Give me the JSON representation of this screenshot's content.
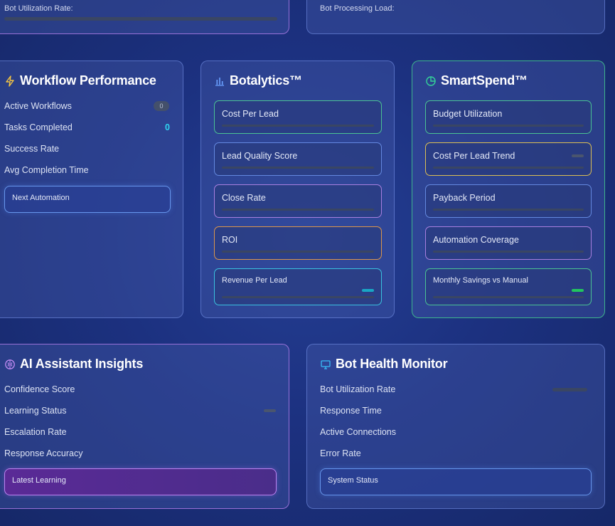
{
  "top_left_card": {
    "label": "Bot Utilization Rate:"
  },
  "top_right_card": {
    "label": "Bot Processing Load:"
  },
  "workflow": {
    "title": "Workflow Performance",
    "icon": "lightning-icon",
    "rows": [
      {
        "label": "Active Workflows",
        "value": "0"
      },
      {
        "label": "Tasks Completed",
        "value": "0"
      },
      {
        "label": "Success Rate"
      },
      {
        "label": "Avg Completion Time"
      }
    ],
    "next_automation": "Next Automation"
  },
  "botalytics": {
    "title": "Botalytics™",
    "icon": "bar-chart-icon",
    "items": [
      {
        "label": "Cost Per Lead"
      },
      {
        "label": "Lead Quality Score"
      },
      {
        "label": "Close Rate"
      },
      {
        "label": "ROI"
      },
      {
        "label": "Revenue Per Lead"
      }
    ]
  },
  "smartspend": {
    "title": "SmartSpend™",
    "icon": "pie-chart-icon",
    "items": [
      {
        "label": "Budget Utilization"
      },
      {
        "label": "Cost Per Lead Trend"
      },
      {
        "label": "Payback Period"
      },
      {
        "label": "Automation Coverage"
      },
      {
        "label": "Monthly Savings vs Manual"
      }
    ]
  },
  "ai_insights": {
    "title": "AI Assistant Insights",
    "icon": "brain-icon",
    "rows": [
      {
        "label": "Confidence Score"
      },
      {
        "label": "Learning Status"
      },
      {
        "label": "Escalation Rate"
      },
      {
        "label": "Response Accuracy"
      }
    ],
    "latest_learning": "Latest Learning"
  },
  "bot_health": {
    "title": "Bot Health Monitor",
    "icon": "monitor-icon",
    "rows": [
      {
        "label": "Bot Utilization Rate"
      },
      {
        "label": "Response Time"
      },
      {
        "label": "Active Connections"
      },
      {
        "label": "Error Rate"
      }
    ],
    "system_status": "System Status"
  },
  "colors": {
    "accent_cyan": "#2fd3f0",
    "accent_green": "#22c55e",
    "accent_yellow": "#facc15",
    "accent_purple": "#b07cf0",
    "accent_orange": "#f0a046"
  }
}
